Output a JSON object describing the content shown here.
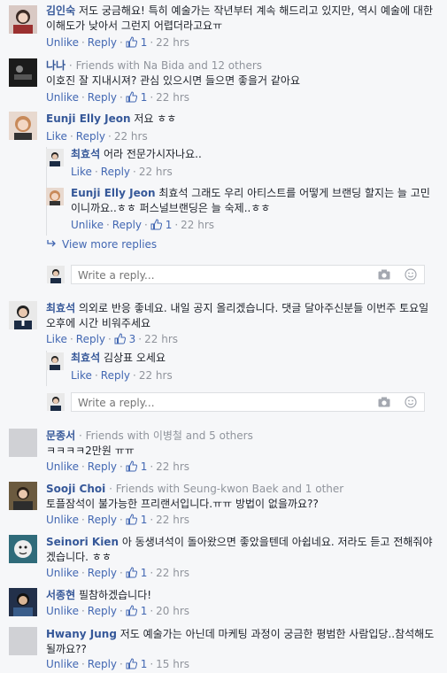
{
  "labels": {
    "like": "Like",
    "unlike": "Unlike",
    "reply": "Reply",
    "view_more": "View more replies",
    "write_reply_placeholder": "Write a reply...",
    "dot": "·"
  },
  "comments": [
    {
      "name": "김인숙",
      "text": "저도 궁금해요! 특히 예술가는 작년부터 계속 해드리고 있지만, 역시 예술에 대한 이해도가 낮아서 그런지 어렵더라고요ㅠ",
      "like_label": "Unlike",
      "likes": "1",
      "time": "22 hrs"
    },
    {
      "name": "나나",
      "friends": "Friends with Na Bida and 12 others",
      "text": "이호진 잘 지내시져? 관심 있으시면 들으면 좋을거 같아요",
      "like_label": "Unlike",
      "likes": "1",
      "time": "22 hrs"
    },
    {
      "name": "Eunji Elly Jeon",
      "text": "저요 ㅎㅎ",
      "like_label": "Like",
      "likes": "",
      "time": "22 hrs",
      "replies": [
        {
          "name": "최효석",
          "text": "어라 전문가시자나요..",
          "like_label": "Like",
          "likes": "",
          "time": "22 hrs"
        },
        {
          "name": "Eunji Elly Jeon",
          "text": "최효석 그래도 우리 아티스트를 어떻게 브랜딩 할지는 늘 고민이니까요..ㅎㅎ 퍼스널브랜딩은 늘 숙제..ㅎㅎ",
          "like_label": "Unlike",
          "likes": "1",
          "time": "22 hrs"
        }
      ]
    },
    {
      "name": "최효석",
      "text": "의외로 반응 좋네요. 내일 공지 올리겠습니다. 댓글 달아주신분들 이번주 토요일 오후에 시간 비워주세요",
      "like_label": "Like",
      "likes": "3",
      "time": "22 hrs",
      "replies": [
        {
          "name": "최효석",
          "text": "김상표 오세요",
          "like_label": "Like",
          "likes": "",
          "time": "22 hrs"
        }
      ]
    },
    {
      "name": "문종서",
      "friends": "Friends with 이병철 and 5 others",
      "text": "ㅋㅋㅋㅋ2만원 ㅠㅠ",
      "like_label": "Unlike",
      "likes": "1",
      "time": "22 hrs"
    },
    {
      "name": "Sooji Choi",
      "friends": "Friends with Seung-kwon Baek and 1 other",
      "text": "토플잠석이 불가능한 프리랜서입니다.ㅠㅠ 방법이 없을까요??",
      "like_label": "Unlike",
      "likes": "1",
      "time": "22 hrs"
    },
    {
      "name": "Seinori Kien",
      "text": "아 동생녀석이 돌아왔으면 좋았을텐데 아쉽네요. 저라도 듣고 전해줘야겠습니다. ㅎㅎ",
      "like_label": "Unlike",
      "likes": "1",
      "time": "22 hrs"
    },
    {
      "name": "서종현",
      "text": "필참하겠습니다!",
      "like_label": "Unlike",
      "likes": "1",
      "time": "20 hrs"
    },
    {
      "name": "Hwany Jung",
      "text": "저도 예술가는 아닌데 마케팅 과정이 궁금한 평범한 사람입당..참석해도 될까요??",
      "like_label": "Unlike",
      "likes": "1",
      "time": "15 hrs"
    }
  ]
}
